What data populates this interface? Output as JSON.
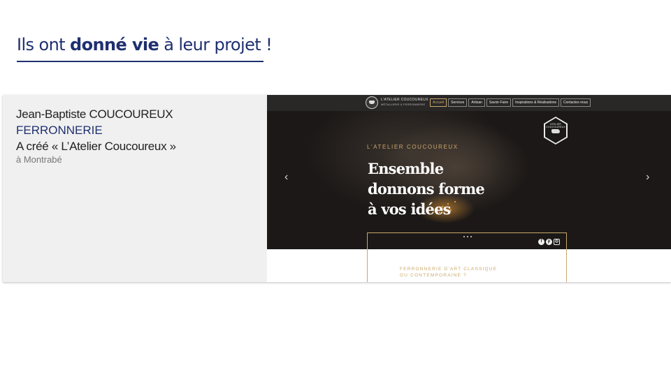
{
  "slide": {
    "title_prefix": "Ils ont ",
    "title_bold": "donné vie",
    "title_suffix": " à leur projet !"
  },
  "card": {
    "name": "Jean-Baptiste COUCOUREUX",
    "trade": "FERRONNERIE",
    "created": "A créé « L’Atelier Coucoureux »",
    "location": "à Montrabé"
  },
  "website": {
    "logo_title": "L'ATELIER COUCOUREUX",
    "logo_subtitle": "MÉTALLERIE & FERRONNERIE",
    "menu": [
      "Accueil",
      "Services",
      "Artisan",
      "Savoir-Faire",
      "Inspirations & Réalisations",
      "Contactez-nous"
    ],
    "active_menu": "Accueil",
    "hero_kicker": "L'ATELIER COUCOUREUX",
    "hero_lines": [
      "Ensemble",
      "donnons forme",
      "à vos idées"
    ],
    "badge_text": "ATELIER COUCOUREUX",
    "tagline_lines": [
      "FERRONNERIE D'ART CLASSIQUE",
      "OU CONTEMPORAINE ?"
    ],
    "social_icons": [
      "facebook-icon",
      "pinterest-icon",
      "instagram-icon"
    ]
  },
  "colors": {
    "title_blue": "#1f3070",
    "card_bg": "#f0f0f0",
    "gold": "#c9a86a",
    "hero_dark": "#1b1817"
  }
}
